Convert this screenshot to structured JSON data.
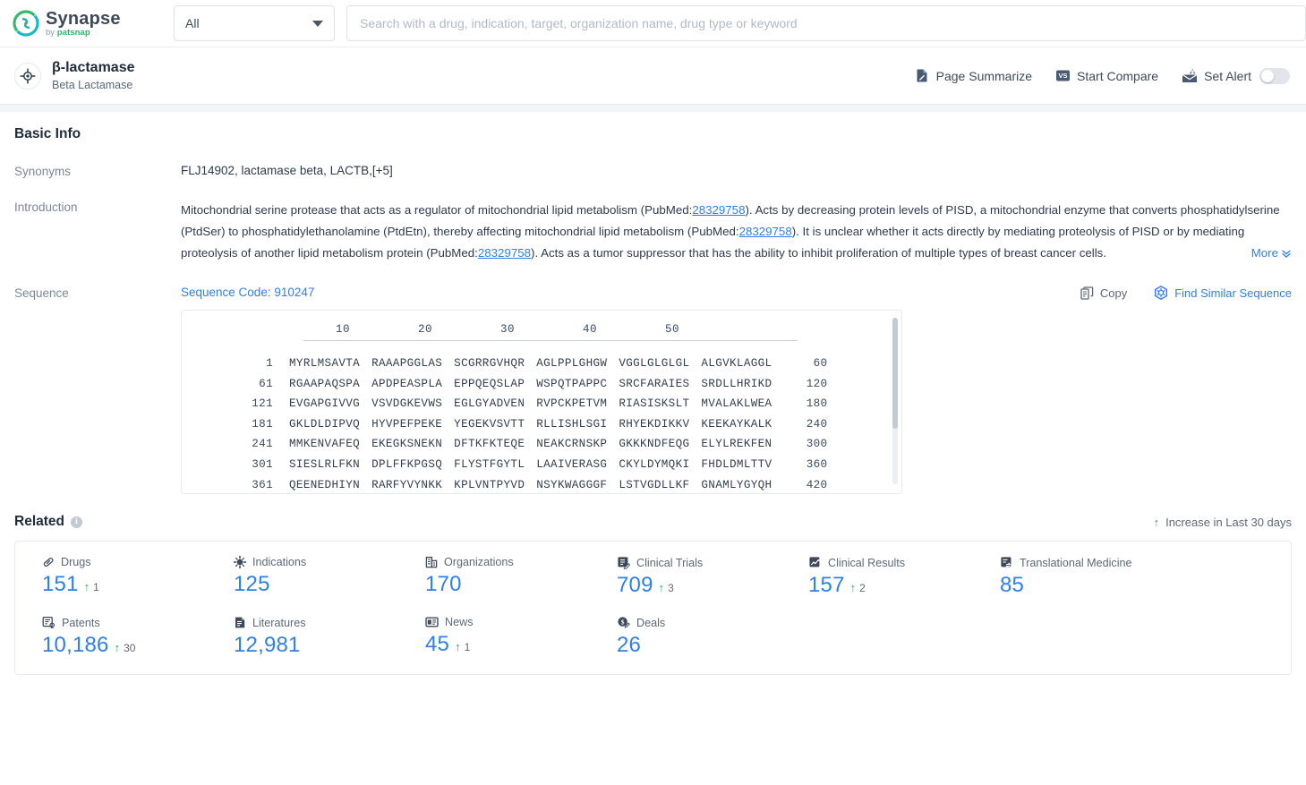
{
  "topbar": {
    "brand_name": "Synapse",
    "brand_by": "by ",
    "brand_sub": "patsnap",
    "scope_value": "All",
    "search_placeholder": "Search with a drug, indication, target, organization name, drug type or keyword",
    "search_value": ""
  },
  "entity": {
    "title": "β-lactamase",
    "subtitle": "Beta Lactamase",
    "actions": {
      "page_summarize": "Page Summarize",
      "start_compare": "Start Compare",
      "set_alert": "Set Alert"
    }
  },
  "basic_info": {
    "heading": "Basic Info",
    "synonyms_label": "Synonyms",
    "synonyms_text": "FLJ14902,  lactamase beta,  LACTB,",
    "synonyms_more": "[+5]",
    "introduction_label": "Introduction",
    "introduction": {
      "p1a": "Mitochondrial serine protease that acts as a regulator of mitochondrial lipid metabolism (PubMed:",
      "ref1": "28329758",
      "p1b": "). Acts by decreasing protein levels of PISD, a mitochondrial enzyme that converts phosphatidylserine (PtdSer) to phosphatidylethanolamine (PtdEtn), thereby affecting mitochondrial lipid metabolism (PubMed:",
      "ref2": "28329758",
      "p1c": "). It is unclear whether it acts directly by mediating proteolysis of PISD or by mediating proteolysis of another lipid metabolism protein (PubMed:",
      "ref3": "28329758",
      "p1d": "). Acts as a tumor suppressor that has the ability to inhibit proliferation of multiple types of breast cancer cells.",
      "more_label": "More"
    },
    "sequence_label": "Sequence",
    "sequence_code": "Sequence Code: 910247",
    "copy_label": "Copy",
    "find_similar_label": "Find Similar Sequence",
    "sequence_ruler": [
      "10",
      "20",
      "30",
      "40",
      "50"
    ],
    "sequence_rows": [
      {
        "start": "1",
        "chunks": [
          "MYRLMSAVTA",
          "RAAAPGGLAS",
          "SCGRRGVHQR",
          "AGLPPLGHGW",
          "VGGLGLGLGL",
          "ALGVKLAGGL"
        ],
        "end": "60"
      },
      {
        "start": "61",
        "chunks": [
          "RGAAPAQSPA",
          "APDPEASPLA",
          "EPPQEQSLAP",
          "WSPQTPAPPC",
          "SRCFARAIES",
          "SRDLLHRIKD"
        ],
        "end": "120"
      },
      {
        "start": "121",
        "chunks": [
          "EVGAPGIVVG",
          "VSVDGKEVWS",
          "EGLGYADVEN",
          "RVPCKPETVM",
          "RIASISKSLT",
          "MVALAKLWEA"
        ],
        "end": "180"
      },
      {
        "start": "181",
        "chunks": [
          "GKLDLDIPVQ",
          "HYVPEFPEKE",
          "YEGEKVSVTT",
          "RLLISHLSGI",
          "RHYEKDIKKV",
          "KEEKAYKALK"
        ],
        "end": "240"
      },
      {
        "start": "241",
        "chunks": [
          "MMKENVAFEQ",
          "EKEGKSNEKN",
          "DFTKFKTEQE",
          "NEAKCRNSKP",
          "GKKKNDFEQG",
          "ELYLREKFEN"
        ],
        "end": "300"
      },
      {
        "start": "301",
        "chunks": [
          "SIESLRLFKN",
          "DPLFFKPGSQ",
          "FLYSTFGYTL",
          "LAAIVERASG",
          "CKYLDYMQKI",
          "FHDLDMLTTV"
        ],
        "end": "360"
      },
      {
        "start": "361",
        "chunks": [
          "QEENEDHIYN",
          "RARFYVYNKK",
          "KPLVNTPYVD",
          "NSYKWAGGGF",
          "LSTVGDLLKF",
          "GNAMLYGYQH"
        ],
        "end": "420"
      }
    ]
  },
  "related": {
    "heading": "Related",
    "legend": "Increase in Last 30 days",
    "cards": [
      [
        {
          "icon": "capsule-icon",
          "label": "Drugs",
          "value": "151",
          "delta": "1"
        },
        {
          "icon": "virus-icon",
          "label": "Indications",
          "value": "125",
          "delta": ""
        },
        {
          "icon": "building-icon",
          "label": "Organizations",
          "value": "170",
          "delta": ""
        },
        {
          "icon": "trial-icon",
          "label": "Clinical Trials",
          "value": "709",
          "delta": "3"
        },
        {
          "icon": "result-icon",
          "label": "Clinical Results",
          "value": "157",
          "delta": "2"
        },
        {
          "icon": "translate-icon",
          "label": "Translational Medicine",
          "value": "85",
          "delta": ""
        }
      ],
      [
        {
          "icon": "patent-icon",
          "label": "Patents",
          "value": "10,186",
          "delta": "30"
        },
        {
          "icon": "book-icon",
          "label": "Literatures",
          "value": "12,981",
          "delta": ""
        },
        {
          "icon": "news-icon",
          "label": "News",
          "value": "45",
          "delta": "1"
        },
        {
          "icon": "deal-icon",
          "label": "Deals",
          "value": "26",
          "delta": ""
        }
      ]
    ]
  },
  "colors": {
    "accent_blue": "#2e7fe8",
    "green": "#2fa84f",
    "text_dark": "#1f2a3a",
    "text_muted": "#7b8798"
  }
}
